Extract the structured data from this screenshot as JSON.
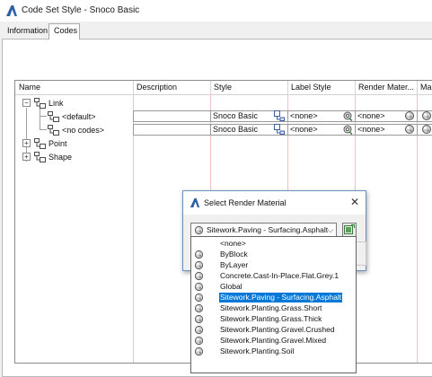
{
  "window": {
    "title": "Code Set Style - Snoco Basic"
  },
  "tabs": [
    {
      "label": "Information",
      "active": false
    },
    {
      "label": "Codes",
      "active": true
    }
  ],
  "grid": {
    "columns": [
      "Name",
      "Description",
      "Style",
      "Label Style",
      "Render Mater...",
      "Ma"
    ],
    "tree": [
      {
        "label": "Link",
        "expander": "−"
      },
      {
        "label": "<default>"
      },
      {
        "label": "<no codes>"
      },
      {
        "label": "Point",
        "expander": "+"
      },
      {
        "label": "Shape",
        "expander": "+"
      }
    ],
    "rows": [
      {
        "style": "Snoco Basic",
        "label_style": "<none>",
        "render_material": "<none>"
      },
      {
        "style": "Snoco Basic",
        "label_style": "<none>",
        "render_material": "<none>"
      }
    ]
  },
  "dialog": {
    "title": "Select Render Material",
    "close_glyph": "✕",
    "selected_value": "Sitework.Paving - Surfacing.Asphalt",
    "dropdown_arrow": "⌵"
  },
  "dropdown": {
    "items": [
      {
        "label": "<none>",
        "icon": false,
        "selected": false
      },
      {
        "label": "ByBlock",
        "icon": true,
        "selected": false
      },
      {
        "label": "ByLayer",
        "icon": true,
        "selected": false
      },
      {
        "label": "Concrete.Cast-In-Place.Flat.Grey.1",
        "icon": true,
        "selected": false
      },
      {
        "label": "Global",
        "icon": true,
        "selected": false
      },
      {
        "label": "Sitework.Paving - Surfacing.Asphalt",
        "icon": true,
        "selected": true
      },
      {
        "label": "Sitework.Planting.Grass.Short",
        "icon": true,
        "selected": false
      },
      {
        "label": "Sitework.Planting.Grass.Thick",
        "icon": true,
        "selected": false
      },
      {
        "label": "Sitework.Planting.Gravel.Crushed",
        "icon": true,
        "selected": false
      },
      {
        "label": "Sitework.Planting.Gravel.Mixed",
        "icon": true,
        "selected": false
      },
      {
        "label": "Sitework.Planting.Soil",
        "icon": true,
        "selected": false
      }
    ]
  },
  "colors": {
    "accent": "#0078d7",
    "column_line": "#efc4c4",
    "app_logo": "#2b5fa8"
  },
  "icons": {
    "app": "autodesk-logo-icon",
    "node": "code-node-icon",
    "style_picker": "style-picker-icon",
    "label_style_picker": "label-style-picker-icon",
    "material": "render-material-icon",
    "browse": "browse-material-icon"
  }
}
